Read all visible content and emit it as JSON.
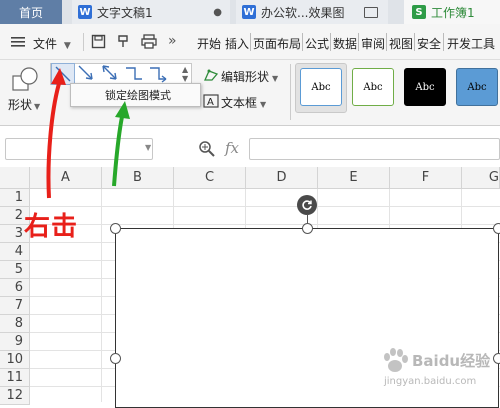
{
  "tabs": {
    "home": "首页",
    "doc": "文字文稿1",
    "img": "办公软...效果图",
    "workbook": "工作簿1"
  },
  "menu": {
    "file": "文件",
    "items": [
      "开始",
      "插入",
      "页面布局",
      "公式",
      "数据",
      "审阅",
      "视图",
      "安全",
      "开发工具"
    ]
  },
  "ribbon": {
    "shapes_label": "形状",
    "edit_shape": "编辑形状",
    "text_box": "文本框",
    "styles": [
      {
        "label": "Abc",
        "bg": "#ffffff",
        "border": "#5b9bd5",
        "fg": "#000000"
      },
      {
        "label": "Abc",
        "bg": "#ffffff",
        "border": "#70ad47",
        "fg": "#000000"
      },
      {
        "label": "Abc",
        "bg": "#000000",
        "border": "#000000",
        "fg": "#ffffff"
      },
      {
        "label": "Abc",
        "bg": "#5b9bd5",
        "border": "#41719c",
        "fg": "#000000"
      }
    ]
  },
  "popup": {
    "lock_drawing_mode": "锁定绘图模式"
  },
  "formula_bar": {
    "fx": "fx",
    "name_box_value": "",
    "formula_value": ""
  },
  "grid": {
    "columns": [
      "A",
      "B",
      "C",
      "D",
      "E",
      "F",
      "G"
    ],
    "rows": [
      "1",
      "2",
      "3",
      "4",
      "5",
      "6",
      "7",
      "8",
      "9",
      "10",
      "11",
      "12"
    ]
  },
  "annotation": {
    "right_click": "右击",
    "color": "#e8201a",
    "green_arrow_color": "#27a82a"
  },
  "watermark": {
    "brand": "Baidu经验",
    "url": "jingyan.baidu.com"
  },
  "colors": {
    "home_tab": "#5f7ea6",
    "workbook_accent": "#2e8b3a",
    "doc_icon": "#2f6fd6",
    "img_icon": "#2f6fd6",
    "workbook_icon": "#2e9c47"
  }
}
